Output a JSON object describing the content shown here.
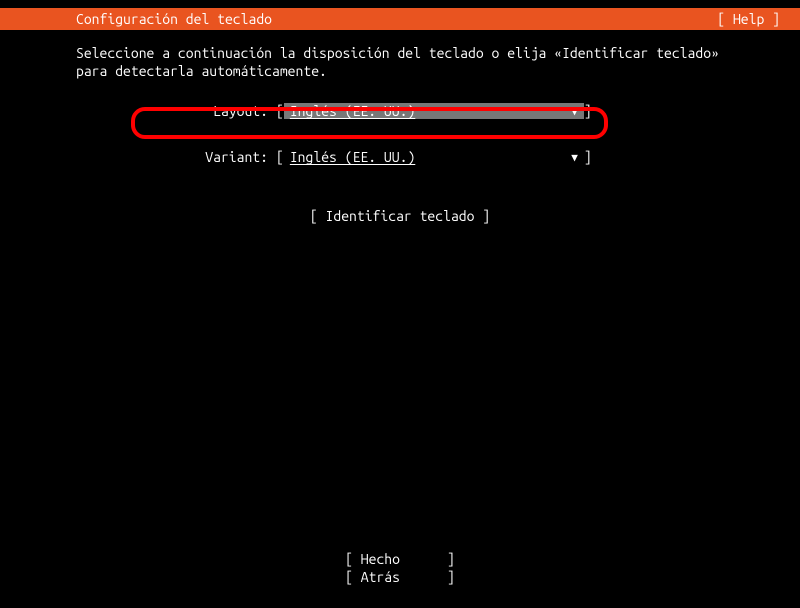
{
  "header": {
    "title": "Configuración del teclado",
    "help": "[ Help ]"
  },
  "instructions": "Seleccione a continuación la disposición del teclado o elija «Identificar teclado» para detectarla automáticamente.",
  "form": {
    "layout": {
      "label": "Layout:",
      "value": "Inglés (EE. UU.)"
    },
    "variant": {
      "label": "Variant:",
      "value": "Inglés (EE. UU.)"
    }
  },
  "identify_button": "[ Identificar teclado ]",
  "footer": {
    "done": "[ Hecho      ]",
    "back": "[ Atrás      ]"
  }
}
